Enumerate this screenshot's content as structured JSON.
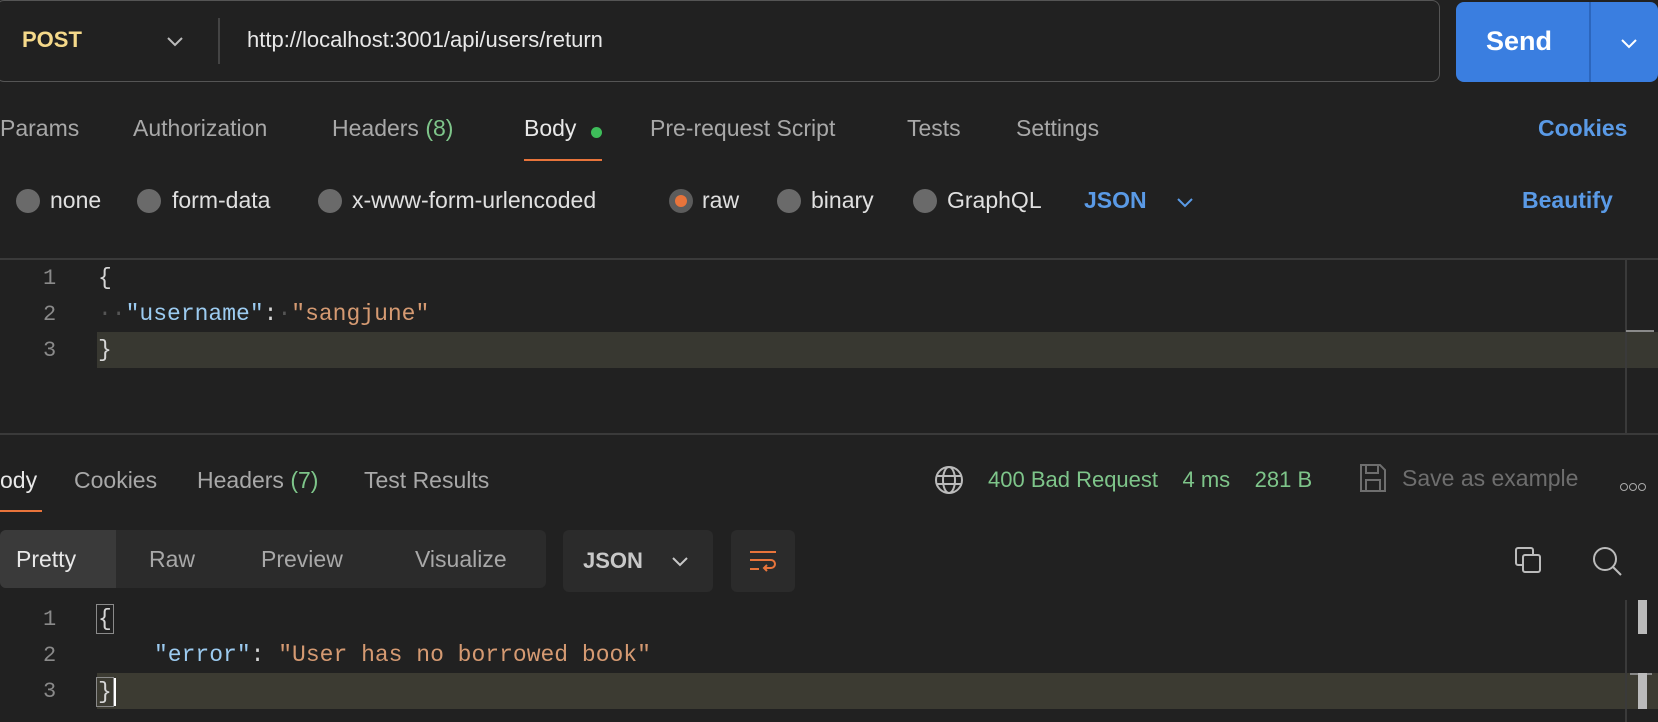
{
  "request": {
    "method": "POST",
    "url": "http://localhost:3001/api/users/return",
    "send_label": "Send"
  },
  "request_tabs": {
    "params": "Params",
    "authorization": "Authorization",
    "headers": "Headers",
    "headers_count": "(8)",
    "body": "Body",
    "pre_request": "Pre-request Script",
    "tests": "Tests",
    "settings": "Settings",
    "cookies": "Cookies"
  },
  "body_types": {
    "none": "none",
    "form_data": "form-data",
    "urlencoded": "x-www-form-urlencoded",
    "raw": "raw",
    "binary": "binary",
    "graphql": "GraphQL",
    "language": "JSON",
    "beautify": "Beautify",
    "selected": "raw"
  },
  "request_editor": {
    "line_numbers": [
      "1",
      "2",
      "3"
    ],
    "open_brace": "{",
    "key": "\"username\"",
    "colon": ":",
    "value": "\"sangjune\"",
    "close_brace": "}"
  },
  "response_tabs": {
    "body": "ody",
    "cookies": "Cookies",
    "headers": "Headers",
    "headers_count": "(7)",
    "test_results": "Test Results"
  },
  "response_meta": {
    "status": "400 Bad Request",
    "time": "4 ms",
    "size": "281 B",
    "save_example": "Save as example"
  },
  "response_view": {
    "pretty": "Pretty",
    "raw": "Raw",
    "preview": "Preview",
    "visualize": "Visualize",
    "format": "JSON"
  },
  "response_editor": {
    "line_numbers": [
      "1",
      "2",
      "3"
    ],
    "open_brace": "{",
    "key": "\"error\"",
    "colon": ":",
    "value": "\"User has no borrowed book\"",
    "close_brace": "}"
  },
  "colors": {
    "accent_blue": "#3a7ee0",
    "link_blue": "#5a9ae6",
    "method_yellow": "#f5d98a",
    "status_green": "#7ec58a",
    "tab_underline_orange": "#e8743b",
    "background": "#212121"
  }
}
